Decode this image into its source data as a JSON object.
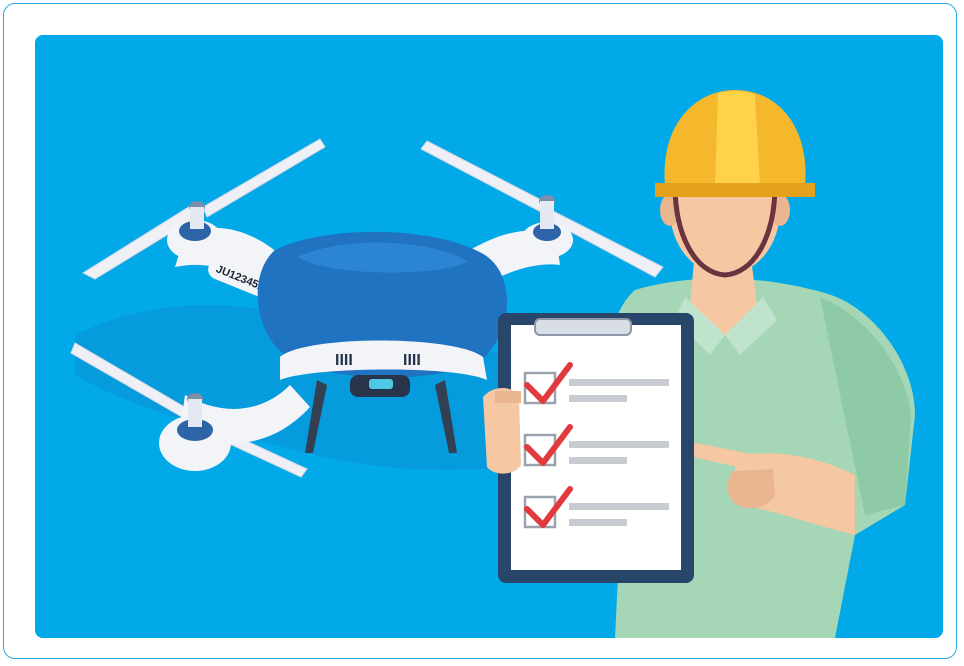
{
  "illustration": {
    "drone": {
      "serial_label": "JU12345ABCDE",
      "vent_left": "IIII",
      "vent_right": "IIII"
    },
    "checklist": {
      "item_count": 3,
      "all_checked": true
    },
    "colors": {
      "frame_border": "#29a8e0",
      "background": "#02a9e9",
      "drone_body": "#1f73c0",
      "drone_white": "#f3f4f8",
      "helmet": "#f5b72b",
      "shirt": "#a5d6b6",
      "skin": "#f6c7a3",
      "clipboard": "#28466a",
      "check": "#e03a3e"
    }
  }
}
